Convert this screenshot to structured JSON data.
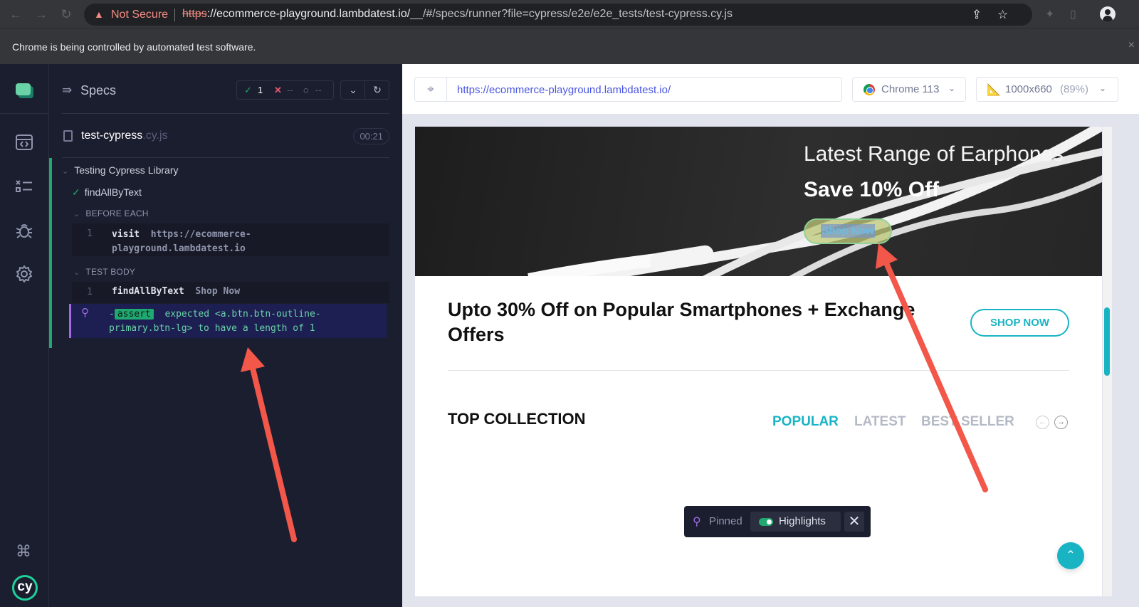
{
  "browser": {
    "security_label": "Not Secure",
    "url_scheme": "https",
    "url_host": "://ecommerce-playground.lambdatest.io/",
    "url_rest": "__/#/specs/runner?file=cypress/e2e/e2e_tests/test-cypress.cy.js",
    "automation_notice": "Chrome is being controlled by automated test software.",
    "close_label": "×"
  },
  "nav": {
    "items": [
      {
        "name": "runs-icon"
      },
      {
        "name": "specs-list-icon"
      },
      {
        "name": "debug-icon"
      },
      {
        "name": "settings-icon"
      }
    ],
    "shortcut_label": "⌘",
    "logo_text": "cy"
  },
  "reporter": {
    "title": "Specs",
    "stats": {
      "passed": "1",
      "failed": "--",
      "pending": "--"
    },
    "spec_file": {
      "name": "test-cypress",
      "ext": ".cy.js",
      "duration": "00:21"
    },
    "suite": {
      "title": "Testing Cypress Library",
      "test": "findAllByText",
      "before_each": {
        "label": "BEFORE EACH",
        "commands": [
          {
            "num": "1",
            "name": "visit",
            "msg_line1": "https://ecommerce-",
            "msg_line2": "playground.lambdatest.io"
          }
        ]
      },
      "test_body": {
        "label": "TEST BODY",
        "commands": [
          {
            "num": "1",
            "name": "findAllByText",
            "msg": "Shop Now"
          }
        ],
        "assertion": {
          "prefix": "-",
          "badge": "assert",
          "line1": "expected <a.btn.btn-outline-",
          "line2": "primary.btn-lg> to have a length of 1"
        }
      }
    }
  },
  "aut": {
    "url": "https://ecommerce-playground.lambdatest.io/",
    "browser_label": "Chrome 113",
    "viewport_label": "1000x660",
    "viewport_scale": "(89%)",
    "hero": {
      "title": "Latest Range of Earphones",
      "subtitle": "Save 10% Off",
      "button": "Shop Now"
    },
    "promo": {
      "title": "Upto 30% Off on Popular Smartphones + Exchange Offers",
      "button": "SHOP NOW"
    },
    "collection": {
      "title": "TOP COLLECTION",
      "tabs": [
        "POPULAR",
        "LATEST",
        "BEST SELLER"
      ],
      "active_tab": "POPULAR"
    },
    "pin_bar": {
      "pinned_label": "Pinned",
      "highlights_label": "Highlights",
      "highlights_on": true
    },
    "scroll_position": 0.45
  },
  "colors": {
    "accent_teal": "#18b4c4",
    "cypress_green": "#1fa971",
    "pin_purple": "#a06ce4",
    "annotation_red": "#f2574a"
  }
}
